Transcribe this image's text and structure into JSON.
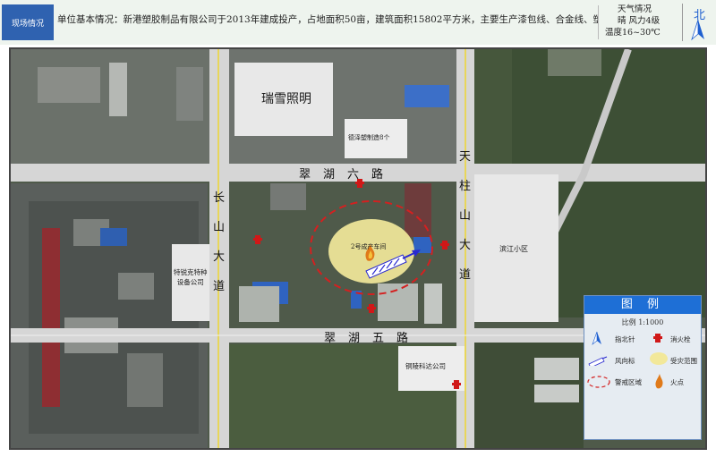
{
  "header": {
    "tag": "现场情况",
    "description": "单位基本情况：新港塑胶制品有限公司于2013年建成投产，占地面积50亩，建筑面积15802平方米，主要生产漆包线、合金线、塑料线盘。"
  },
  "weather": {
    "title": "天气情况",
    "condition": "晴  风力4级",
    "temperature": "温度16~30℃"
  },
  "north": {
    "label": "北"
  },
  "map": {
    "labels": {
      "ruixue": "瑞雪照明",
      "jiefu": "德泽塑制造8个",
      "workshop": "2号成产车间",
      "tebaike": "特锐克特种\n设备公司",
      "binjiang": "滨江小区",
      "tonglin": "铜陵科达公司"
    },
    "roads": {
      "cuihu6": [
        "翠",
        "湖",
        "六",
        "路"
      ],
      "cuihu5": [
        "翠",
        "湖",
        "五",
        "路"
      ],
      "changshan": [
        "长",
        "山",
        "大",
        "道"
      ],
      "tianzhushan": [
        "天",
        "柱",
        "山",
        "大",
        "道"
      ]
    }
  },
  "legend": {
    "title": "图 例",
    "scale": "比例    1:1000",
    "items": {
      "north": "指北针",
      "hydrant": "消火栓",
      "wind": "风向标",
      "affected": "受灾范围",
      "alert": "警戒区域",
      "fire": "火点"
    }
  },
  "colors": {
    "header_tag": "#2f62b0",
    "legend_title": "#1e6fd6",
    "alert_line": "#d42020",
    "affected_fill": "#f2e89a",
    "road": "#d6d6d6",
    "road_center": "#e8d65a",
    "wind_arrow": "#2a2ad0",
    "hydrant": "#d01818"
  }
}
